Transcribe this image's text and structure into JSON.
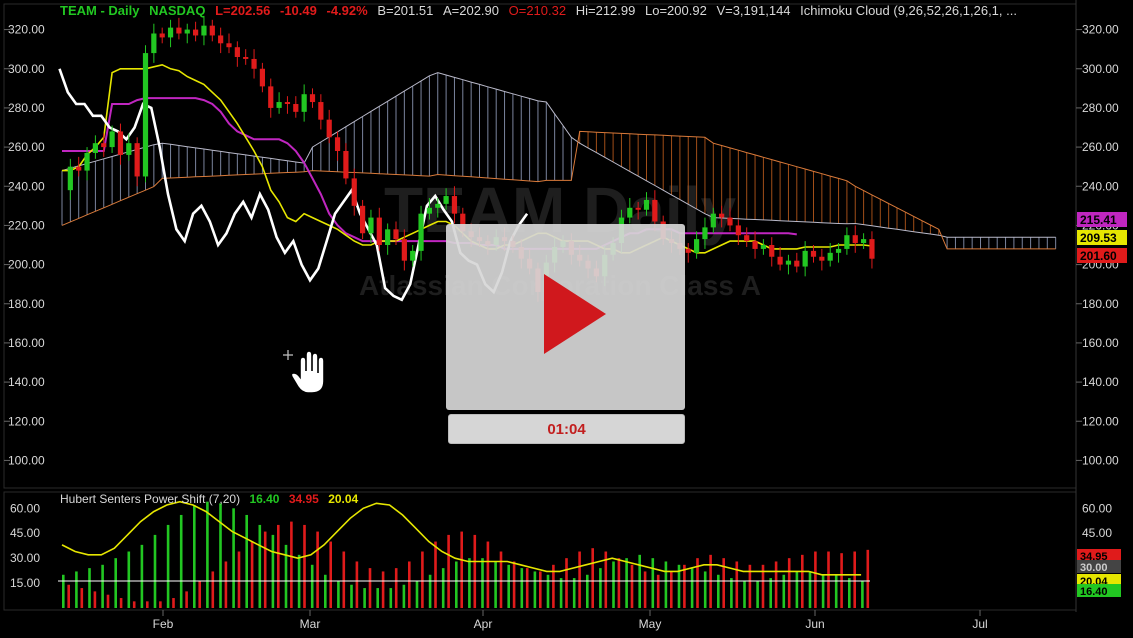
{
  "header": {
    "symbol": "TEAM - Daily",
    "exchange": "NASDAQ",
    "last": "L=202.56",
    "change": "-10.49",
    "change_pct": "-4.92%",
    "bid": "B=201.51",
    "ask": "A=202.90",
    "open": "O=210.32",
    "high": "Hi=212.99",
    "low": "Lo=200.92",
    "volume": "V=3,191,144",
    "study": "Ichimoku Cloud (9,26,52,26,1,26,1, ..."
  },
  "watermark": {
    "ticker": "TEAM Daily",
    "company": "Atlassian Corporation Class A"
  },
  "price_axis": {
    "ticks": [
      "320.00",
      "300.00",
      "280.00",
      "260.00",
      "240.00",
      "220.00",
      "200.00",
      "180.00",
      "160.00",
      "140.00",
      "120.00",
      "100.00"
    ],
    "tags": [
      {
        "text": "215.41",
        "color": "#c026c0"
      },
      {
        "text": "209.53",
        "color": "#e6e600"
      },
      {
        "text": "201.60",
        "color": "#e01b1b"
      }
    ]
  },
  "indicator": {
    "title": "Hubert Senters Power Shift (7,20)",
    "val1": "16.40",
    "val2": "34.95",
    "val3": "20.04",
    "ticks": [
      "60.00",
      "45.00",
      "30.00",
      "15.00"
    ],
    "tags": [
      {
        "text": "34.95",
        "color": "#e01b1b"
      },
      {
        "text": "30.00",
        "color": "#444444"
      },
      {
        "text": "20.04",
        "color": "#e6e600"
      },
      {
        "text": "16.40",
        "color": "#22c722"
      }
    ]
  },
  "time_axis": {
    "labels": [
      "Feb",
      "Mar",
      "Apr",
      "May",
      "Jun",
      "Jul"
    ]
  },
  "player": {
    "time": "01:04",
    "play_icon": "play-icon"
  },
  "colors": {
    "up": "#22c722",
    "down": "#e01b1b",
    "tenkan": "#e6e600",
    "kijun": "#c026c0",
    "lagging": "#ffffff",
    "cloud_bull": "#9aa6c6",
    "cloud_bear": "#c8621e",
    "play": "#d0181d"
  },
  "chart_data": {
    "type": "candlestick",
    "price_range": [
      90,
      330
    ],
    "closes": [
      238,
      250,
      248,
      257,
      262,
      260,
      268,
      256,
      262,
      245,
      308,
      318,
      316,
      321,
      318,
      320,
      317,
      322,
      317,
      313,
      311,
      306,
      305,
      300,
      291,
      280,
      283,
      282,
      278,
      287,
      283,
      274,
      265,
      258,
      244,
      230,
      216,
      224,
      210,
      218,
      213,
      202,
      207,
      226,
      229,
      231,
      235,
      226,
      217,
      214,
      212,
      210,
      214,
      212,
      209,
      203,
      198,
      186,
      201,
      209,
      212,
      205,
      202,
      198,
      194,
      205,
      211,
      224,
      229,
      228,
      233,
      222,
      213,
      211,
      208,
      206,
      213,
      219,
      226,
      224,
      220,
      215,
      212,
      208,
      210,
      204,
      200,
      202,
      199,
      207,
      204,
      202,
      206,
      208,
      215,
      211,
      213,
      203
    ],
    "ichimoku": {
      "tenkan": [
        248,
        248,
        250,
        256,
        260,
        265,
        298,
        300,
        300,
        300,
        300,
        301,
        302,
        300,
        299,
        296,
        294,
        292,
        288,
        284,
        278,
        272,
        265,
        258,
        250,
        238,
        232,
        224,
        222,
        226,
        224,
        222,
        220,
        218,
        215,
        212,
        210,
        210,
        212,
        212,
        212,
        214,
        216,
        218,
        220,
        222,
        222,
        220,
        216,
        212,
        210,
        208,
        208,
        210,
        210,
        212,
        214,
        216,
        216,
        214,
        212,
        212,
        212,
        212,
        210,
        208,
        208,
        206,
        206,
        208,
        210,
        212,
        214,
        212,
        210,
        208,
        206,
        206,
        208,
        210,
        212,
        212,
        212,
        212,
        210,
        208,
        208,
        208,
        208,
        209,
        209,
        209,
        209,
        210,
        210,
        210,
        210,
        209.5
      ],
      "kijun": [
        258,
        258,
        258,
        258,
        258,
        258,
        282,
        282,
        282,
        284,
        285,
        285,
        285,
        285,
        285,
        285,
        285,
        284,
        282,
        278,
        272,
        268,
        266,
        264,
        264,
        264,
        264,
        262,
        258,
        252,
        244,
        236,
        226,
        220,
        216,
        214,
        212,
        212,
        212,
        212,
        212,
        212,
        212,
        212,
        212,
        212,
        212,
        211,
        211,
        211,
        210,
        210,
        210,
        208,
        208,
        208,
        208,
        208,
        208,
        208,
        208,
        208,
        208,
        208,
        208,
        210,
        212,
        214,
        216,
        216,
        218,
        218,
        218,
        218,
        216,
        216,
        216,
        216,
        216,
        216,
        216,
        216,
        216,
        216,
        216,
        216,
        216,
        216,
        215.4
      ]
    },
    "indicator": {
      "series": [
        {
          "name": "16.40",
          "values": [
            20,
            22,
            24,
            26,
            30,
            34,
            38,
            44,
            50,
            56,
            62,
            64,
            63,
            60,
            56,
            50,
            44,
            38,
            32,
            26,
            20,
            16,
            14,
            12,
            12,
            12,
            14,
            16,
            20,
            24,
            28,
            30,
            30,
            28,
            26,
            24,
            22,
            20,
            18,
            18,
            20,
            24,
            28,
            30,
            32,
            30,
            28,
            26,
            24,
            22,
            20,
            18,
            16,
            16,
            18,
            20,
            22,
            22,
            20,
            20,
            18,
            16
          ]
        },
        {
          "name": "34.95",
          "values": [
            14,
            12,
            10,
            8,
            6,
            4,
            4,
            4,
            6,
            10,
            16,
            22,
            28,
            34,
            40,
            46,
            50,
            52,
            50,
            46,
            40,
            34,
            28,
            24,
            22,
            24,
            28,
            34,
            40,
            44,
            46,
            44,
            40,
            34,
            28,
            24,
            22,
            26,
            30,
            34,
            36,
            34,
            30,
            26,
            22,
            20,
            22,
            26,
            30,
            32,
            30,
            28,
            26,
            26,
            28,
            30,
            32,
            34,
            34,
            33,
            34,
            35
          ]
        },
        {
          "name": "20.04",
          "values": [
            38,
            34,
            32,
            32,
            36,
            44,
            52,
            58,
            62,
            64,
            62,
            58,
            52,
            46,
            42,
            38,
            34,
            32,
            30,
            32,
            38,
            46,
            54,
            60,
            63,
            62,
            56,
            48,
            40,
            34,
            30,
            28,
            28,
            28,
            28,
            26,
            24,
            22,
            22,
            24,
            26,
            28,
            30,
            28,
            26,
            24,
            22,
            22,
            24,
            26,
            26,
            24,
            22,
            22,
            22,
            22,
            22,
            22,
            20,
            20,
            20,
            20
          ]
        }
      ],
      "ylim": [
        0,
        65
      ]
    }
  }
}
